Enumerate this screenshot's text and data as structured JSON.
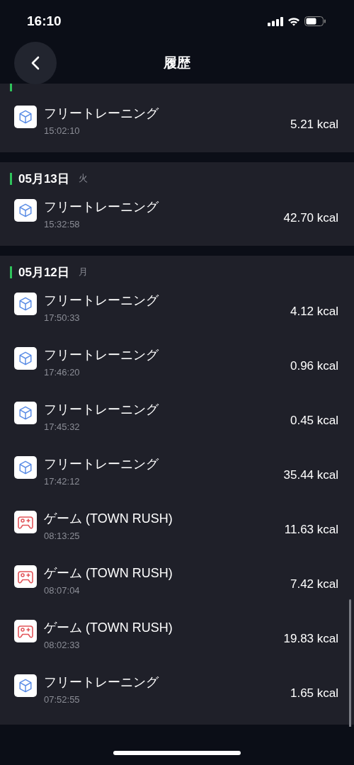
{
  "status_bar": {
    "time": "16:10"
  },
  "nav": {
    "title": "履歴"
  },
  "sections": [
    {
      "entries": [
        {
          "kind": "training",
          "title": "フリートレーニング",
          "time": "15:02:10",
          "kcal": "5.21 kcal"
        }
      ]
    },
    {
      "date": "05月13日",
      "weekday": "火",
      "entries": [
        {
          "kind": "training",
          "title": "フリートレーニング",
          "time": "15:32:58",
          "kcal": "42.70 kcal"
        }
      ]
    },
    {
      "date": "05月12日",
      "weekday": "月",
      "entries": [
        {
          "kind": "training",
          "title": "フリートレーニング",
          "time": "17:50:33",
          "kcal": "4.12 kcal"
        },
        {
          "kind": "training",
          "title": "フリートレーニング",
          "time": "17:46:20",
          "kcal": "0.96 kcal"
        },
        {
          "kind": "training",
          "title": "フリートレーニング",
          "time": "17:45:32",
          "kcal": "0.45 kcal"
        },
        {
          "kind": "training",
          "title": "フリートレーニング",
          "time": "17:42:12",
          "kcal": "35.44 kcal"
        },
        {
          "kind": "game",
          "title": "ゲーム (TOWN RUSH)",
          "time": "08:13:25",
          "kcal": "11.63 kcal"
        },
        {
          "kind": "game",
          "title": "ゲーム (TOWN RUSH)",
          "time": "08:07:04",
          "kcal": "7.42 kcal"
        },
        {
          "kind": "game",
          "title": "ゲーム (TOWN RUSH)",
          "time": "08:02:33",
          "kcal": "19.83 kcal"
        },
        {
          "kind": "training",
          "title": "フリートレーニング",
          "time": "07:52:55",
          "kcal": "1.65 kcal"
        }
      ]
    }
  ]
}
